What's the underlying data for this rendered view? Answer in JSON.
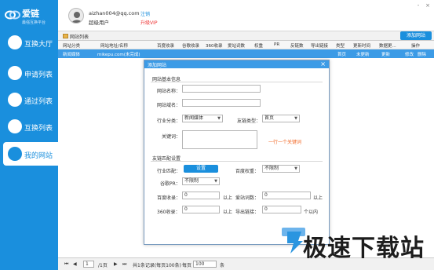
{
  "app": {
    "logo_title": "爱链",
    "logo_subtitle": "最强互换平台"
  },
  "sidebar": {
    "items": [
      {
        "label": "互换大厅",
        "icon": "exchange-hall-icon"
      },
      {
        "label": "申请列表",
        "icon": "application-list-icon"
      },
      {
        "label": "通过列表",
        "icon": "approved-list-icon"
      },
      {
        "label": "互换列表",
        "icon": "swap-list-icon"
      },
      {
        "label": "我的网站",
        "icon": "my-sites-icon",
        "active": true
      }
    ]
  },
  "header": {
    "email": "aizhan004@qq.com",
    "level": "超级用户",
    "logout": "注销",
    "upgrade": "升级VIP",
    "window_controls": [
      "-",
      "×"
    ]
  },
  "tab": {
    "label": "网站列表",
    "add_button": "添加网站"
  },
  "table": {
    "columns": [
      "网站分类",
      "网站地址/名称",
      "百度收录",
      "谷歌收录",
      "360收录",
      "爱站词数",
      "权重",
      "PR",
      "反链数",
      "导出链接",
      "类型",
      "更新时间",
      "数据更...",
      "操作"
    ],
    "rows": [
      {
        "category": "新闻媒体",
        "url": "mikepu.com(未完成)",
        "type": "首页",
        "update": "未更新",
        "data": "更新",
        "ops": [
          "修改",
          "删除"
        ]
      }
    ]
  },
  "pager": {
    "page_value": "1",
    "total_pages": "/1页",
    "summary": "共1条记录(每页100条)",
    "per_page_label": "每页",
    "per_page_value": "100",
    "unit": "条"
  },
  "dialog": {
    "title": "添加网站",
    "close": "×",
    "section_basic": "网站基本信息",
    "name_label": "网站名称：",
    "name_value": "",
    "domain_label": "网站域名：",
    "domain_value": "",
    "industry_label": "行业分类：",
    "industry_value": "新闻媒体",
    "link_type_label": "友链类型：",
    "link_type_value": "首页",
    "keywords_label": "关键词：",
    "keywords_hint": "一行一个关键词",
    "section_match": "友链匹配设置",
    "industry_match_label": "行业匹配：",
    "industry_match_button": "设置",
    "weight_label": "百度权重：",
    "weight_value": "不限制",
    "pr_label": "谷歌PR：",
    "pr_value": "不限制",
    "baidu_label": "百度收录：",
    "baidu_value": "0",
    "above1": "以上",
    "aizhan_label": "爱站词数：",
    "aizhan_value": "0",
    "above2": "以上",
    "s360_label": "360收录：",
    "s360_value": "0",
    "above3": "以上",
    "export_label": "导出链接：",
    "export_value": "0",
    "within": "个以内"
  },
  "watermark": {
    "text": "极速下载站"
  },
  "colors": {
    "brand": "#1a8fdd",
    "row_selected": "#3c9be6",
    "hint": "#f26b2a",
    "upgrade": "#ee3333"
  }
}
